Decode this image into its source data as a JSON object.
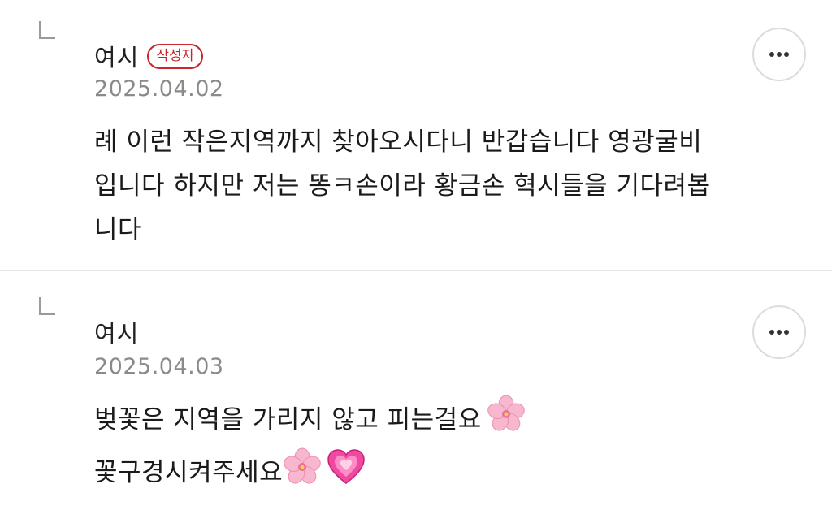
{
  "comments": [
    {
      "author": "여시",
      "badge": "작성자",
      "date": "2025.04.02",
      "lines": [
        "례 이런 작은지역까지 찾아오시다니 반갑습니다 영광굴비",
        "입니다 하지만 저는 똥ㅋ손이라 황금손 혁시들을 기다려봅",
        "니다"
      ]
    },
    {
      "author": "여시",
      "date": "2025.04.03",
      "lines": [
        "벚꽃은 지역을 가리지 않고 피는걸요",
        "꽃구경시켜주세요"
      ],
      "emojis": [
        "cherry-blossom",
        "cherry-blossom",
        "growing-heart"
      ]
    }
  ],
  "colors": {
    "badge": "#c8252c",
    "date": "#8a8a8a",
    "divider": "#e4e4e4"
  }
}
